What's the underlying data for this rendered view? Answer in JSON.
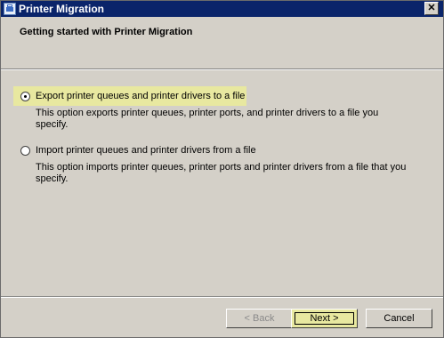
{
  "window": {
    "title": "Printer Migration",
    "icon": "printer-migration-app-icon",
    "close_label": "✕"
  },
  "header": {
    "heading": "Getting started with Printer Migration"
  },
  "options": [
    {
      "label": "Export printer queues and printer drivers to a file",
      "description": "This option exports printer queues, printer ports, and printer drivers to a file you specify.",
      "selected": true
    },
    {
      "label": "Import printer queues and printer drivers from a file",
      "description": "This option imports printer queues, printer ports and printer drivers from a file that you specify.",
      "selected": false
    }
  ],
  "buttons": {
    "back": "< Back",
    "next": "Next >",
    "cancel": "Cancel"
  },
  "colors": {
    "highlight": "#e8e8a0",
    "titlebar": "#0a246a",
    "dialog": "#d4d0c8"
  }
}
